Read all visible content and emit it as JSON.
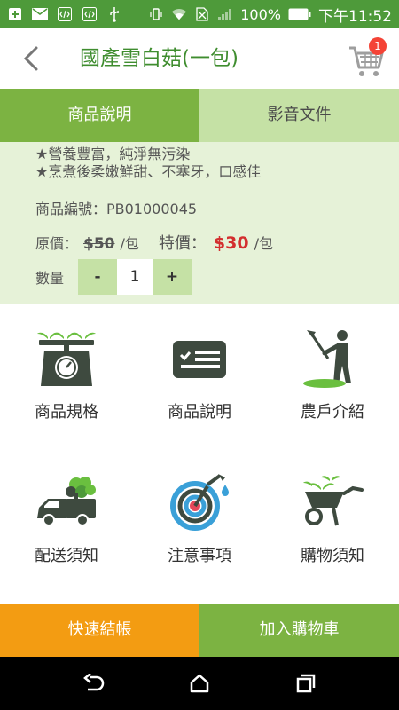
{
  "status_bar": {
    "battery_percent": "100%",
    "time": "下午11:52",
    "icons": [
      "plus-icon",
      "mail-icon",
      "code-icon",
      "code-icon",
      "usb-icon",
      "vibrate-icon",
      "wifi-icon",
      "no-sim-icon",
      "signal-icon",
      "battery-icon"
    ]
  },
  "header": {
    "title": "國產雪白菇(一包)",
    "cart_badge": "1",
    "back_icon": "chevron-left-icon",
    "cart_icon": "cart-icon"
  },
  "tabs": [
    {
      "label": "商品說明",
      "active": true
    },
    {
      "label": "影音文件",
      "active": false
    }
  ],
  "description": {
    "line1": "★營養豐富，純淨無污染",
    "line2": "★烹煮後柔嫩鮮甜、不塞牙，口感佳",
    "product_code": "商品編號：PB01000045",
    "original_label": "原價：",
    "original_price": "$50",
    "original_unit": "/包",
    "sale_label": "特價：",
    "sale_price": "$30",
    "sale_unit": "/包",
    "qty_label": "數量",
    "qty_minus": "-",
    "qty_value": "1",
    "qty_plus": "+"
  },
  "grid": [
    {
      "label": "商品規格",
      "icon": "scale-icon"
    },
    {
      "label": "商品說明",
      "icon": "description-card-icon"
    },
    {
      "label": "農戶介紹",
      "icon": "farmer-icon"
    },
    {
      "label": "配送須知",
      "icon": "delivery-truck-icon"
    },
    {
      "label": "注意事項",
      "icon": "hose-icon"
    },
    {
      "label": "購物須知",
      "icon": "wheelbarrow-icon"
    }
  ],
  "actions": {
    "checkout": "快速結帳",
    "add_to_cart": "加入購物車"
  },
  "colors": {
    "primary_green": "#7cb342",
    "dark_green": "#3f8d2f",
    "light_green": "#c5e1a5",
    "panel_bg": "#e6f2d8",
    "orange": "#f39c12",
    "price_red": "#d32f2f",
    "icon_dark": "#3e4a3f"
  }
}
